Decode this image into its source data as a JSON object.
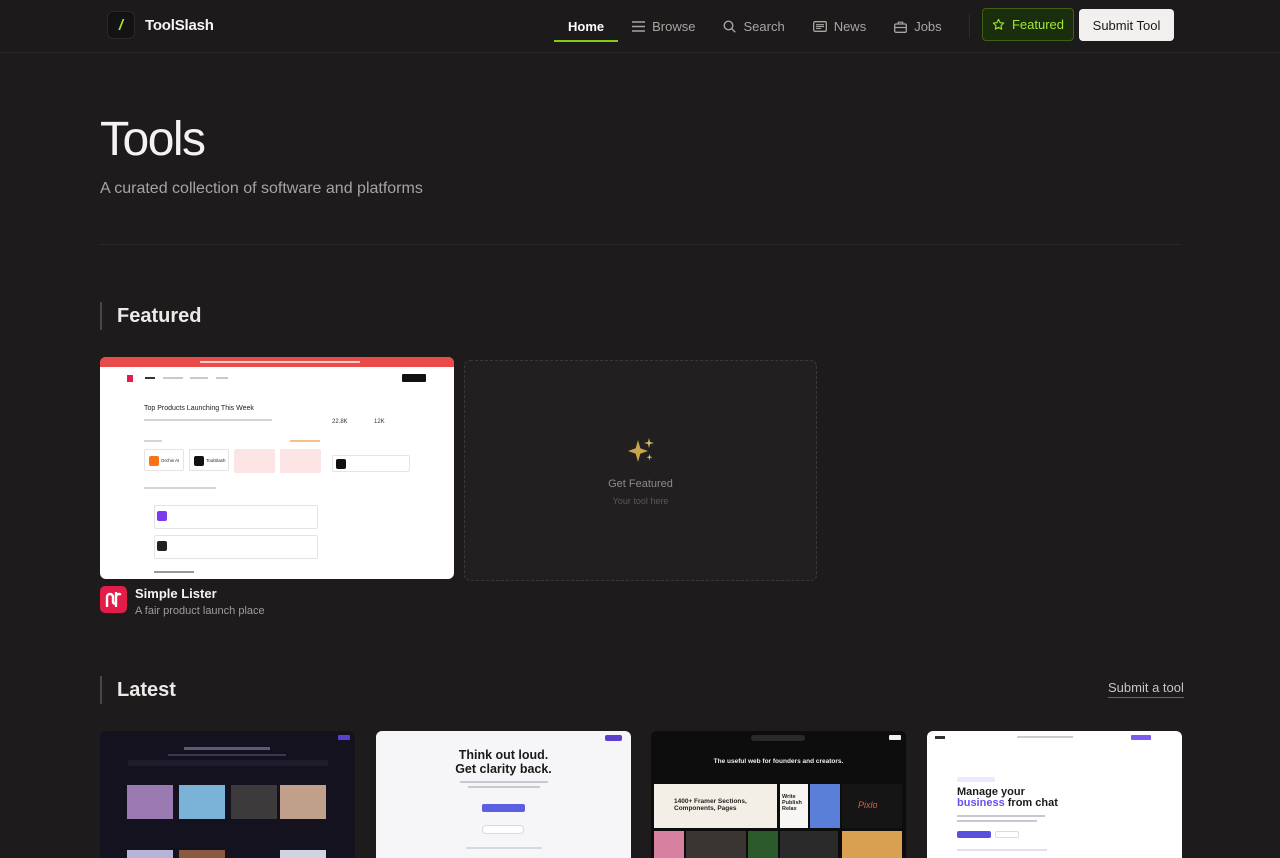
{
  "brand": {
    "mark": "/",
    "name": "ToolSlash"
  },
  "nav": {
    "items": [
      {
        "label": "Home",
        "icon": "none",
        "active": true
      },
      {
        "label": "Browse",
        "icon": "menu-icon",
        "active": false
      },
      {
        "label": "Search",
        "icon": "search-icon",
        "active": false
      },
      {
        "label": "News",
        "icon": "newspaper-icon",
        "active": false
      },
      {
        "label": "Jobs",
        "icon": "briefcase-icon",
        "active": false
      }
    ],
    "featured_label": "Featured",
    "submit_label": "Submit Tool"
  },
  "hero": {
    "title": "Tools",
    "subtitle": "A curated collection of software and platforms"
  },
  "featured": {
    "heading": "Featured",
    "card": {
      "name": "Simple Lister",
      "description": "A fair product launch place",
      "preview": {
        "headline": "Top Products Launching This Week",
        "stat_a": "22.8K",
        "stat_b": "12K",
        "item_a": "Orchis AI",
        "item_b": "ToolSlash"
      }
    },
    "placeholder": {
      "title": "Get Featured",
      "subtitle": "Your tool here"
    }
  },
  "latest": {
    "heading": "Latest",
    "submit_link": "Submit a tool",
    "cards": [
      {
        "theme": "dark-gallery"
      },
      {
        "headline_line1": "Think out loud.",
        "headline_line2": "Get clarity back."
      },
      {
        "headline": "The useful web for founders and creators.",
        "promo": "1400+ Framer Sections, Components, Pages",
        "side_text": "Write Publish Relax",
        "logo_text": "Pixlo"
      },
      {
        "headline_a": "Manage your",
        "headline_b": "business",
        "headline_c": "from chat"
      }
    ]
  },
  "colors": {
    "accent": "#84cc16",
    "background": "#1d1b1b",
    "brand_red": "#e11d48"
  }
}
